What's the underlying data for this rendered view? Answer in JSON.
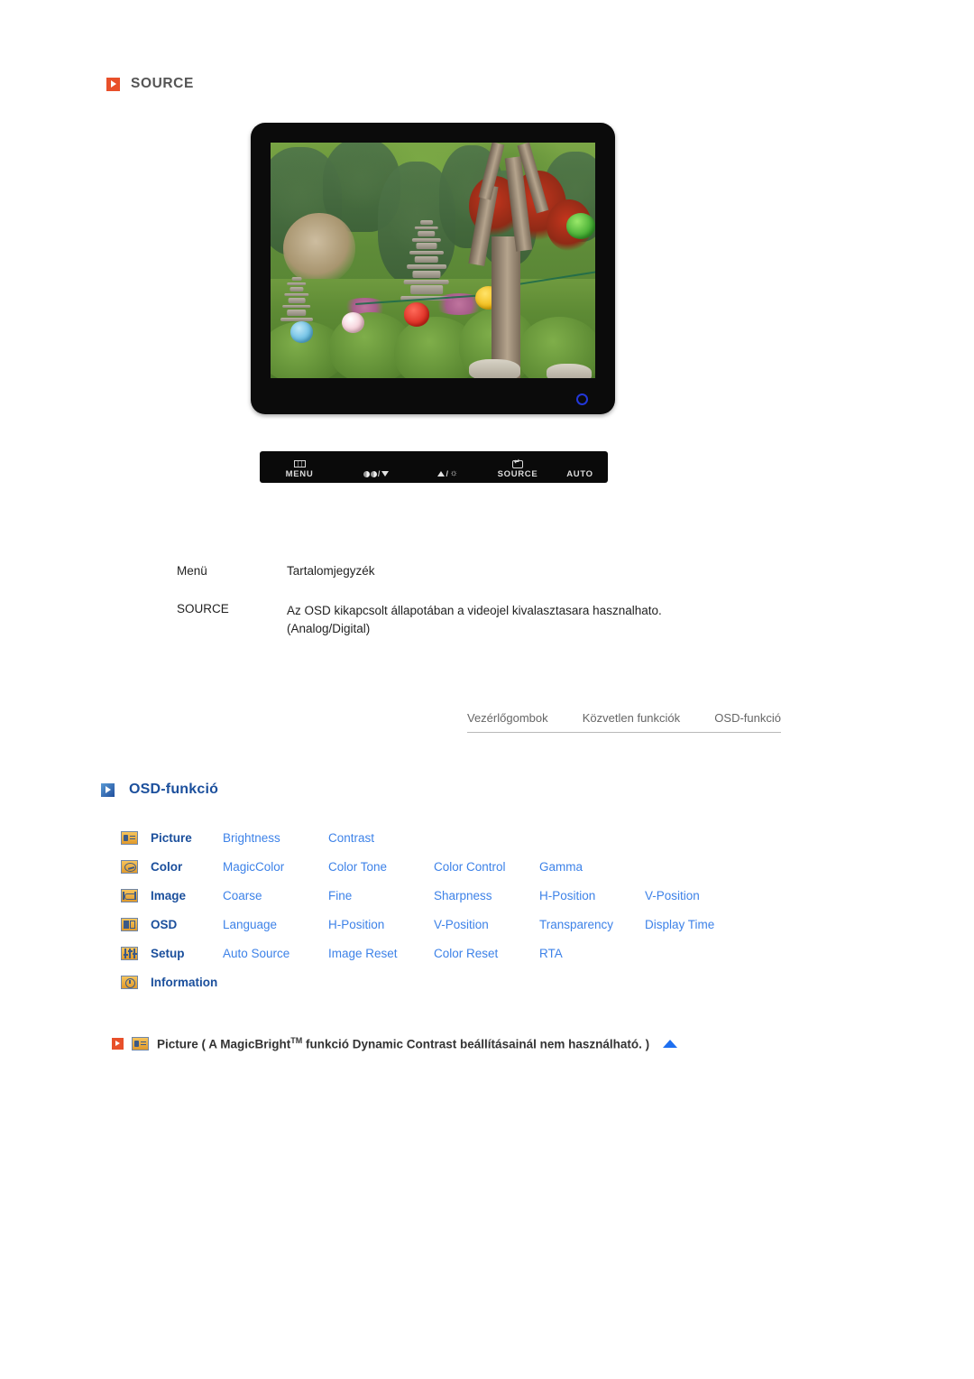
{
  "source_section": {
    "heading": "SOURCE",
    "heading_icon": "orange-play-icon",
    "accent_color": "#E8502A"
  },
  "monitor": {
    "alt": "monitor displaying korean garden photo with stone pagodas and paper lanterns",
    "power_led_color": "#2237d8",
    "buttons": [
      {
        "label": "MENU",
        "icon": "grid-icon"
      },
      {
        "label": "",
        "icon": "magicbright-down-icon"
      },
      {
        "label": "",
        "icon": "up-brightness-icon"
      },
      {
        "label": "SOURCE",
        "icon": "enter-icon"
      },
      {
        "label": "AUTO",
        "icon": ""
      }
    ]
  },
  "menu_table": {
    "headers": {
      "menu": "Menü",
      "contents": "Tartalomjegyzék"
    },
    "rows": [
      {
        "menu": "SOURCE",
        "line1": "Az OSD kikapcsolt állapotában a videojel kivalasztasara hasznalhato.",
        "line2": "(Analog/Digital)"
      }
    ]
  },
  "nav_tabs": [
    {
      "label": "Vezérlőgombok"
    },
    {
      "label": "Közvetlen funkciók"
    },
    {
      "label": "OSD-funkció"
    }
  ],
  "osd_section": {
    "heading": "OSD-funkció",
    "heading_icon": "blue-play-icon",
    "heading_color": "#1b4f9c",
    "item_color": "#3d82e8",
    "rows": [
      {
        "icon": "picture-icon",
        "category": "Picture",
        "items": [
          "Brightness",
          "Contrast"
        ]
      },
      {
        "icon": "color-icon",
        "category": "Color",
        "items": [
          "MagicColor",
          "Color Tone",
          "Color Control",
          "Gamma"
        ]
      },
      {
        "icon": "image-icon",
        "category": "Image",
        "items": [
          "Coarse",
          "Fine",
          "Sharpness",
          "H-Position",
          "V-Position"
        ]
      },
      {
        "icon": "osd-icon",
        "category": "OSD",
        "items": [
          "Language",
          "H-Position",
          "V-Position",
          "Transparency",
          "Display Time"
        ]
      },
      {
        "icon": "setup-icon",
        "category": "Setup",
        "items": [
          "Auto Source",
          "Image Reset",
          "Color Reset",
          "RTA"
        ]
      },
      {
        "icon": "information-icon",
        "category": "Information",
        "items": []
      }
    ]
  },
  "bottom_note": {
    "play_icon": "orange-play-icon",
    "category_icon": "picture-icon",
    "text_before": "Picture ( A MagicBright",
    "superscript": "TM",
    "text_after": " funkció Dynamic Contrast beállításainál nem használható. )",
    "top_arrow_icon": "scroll-to-top-arrow-icon"
  }
}
